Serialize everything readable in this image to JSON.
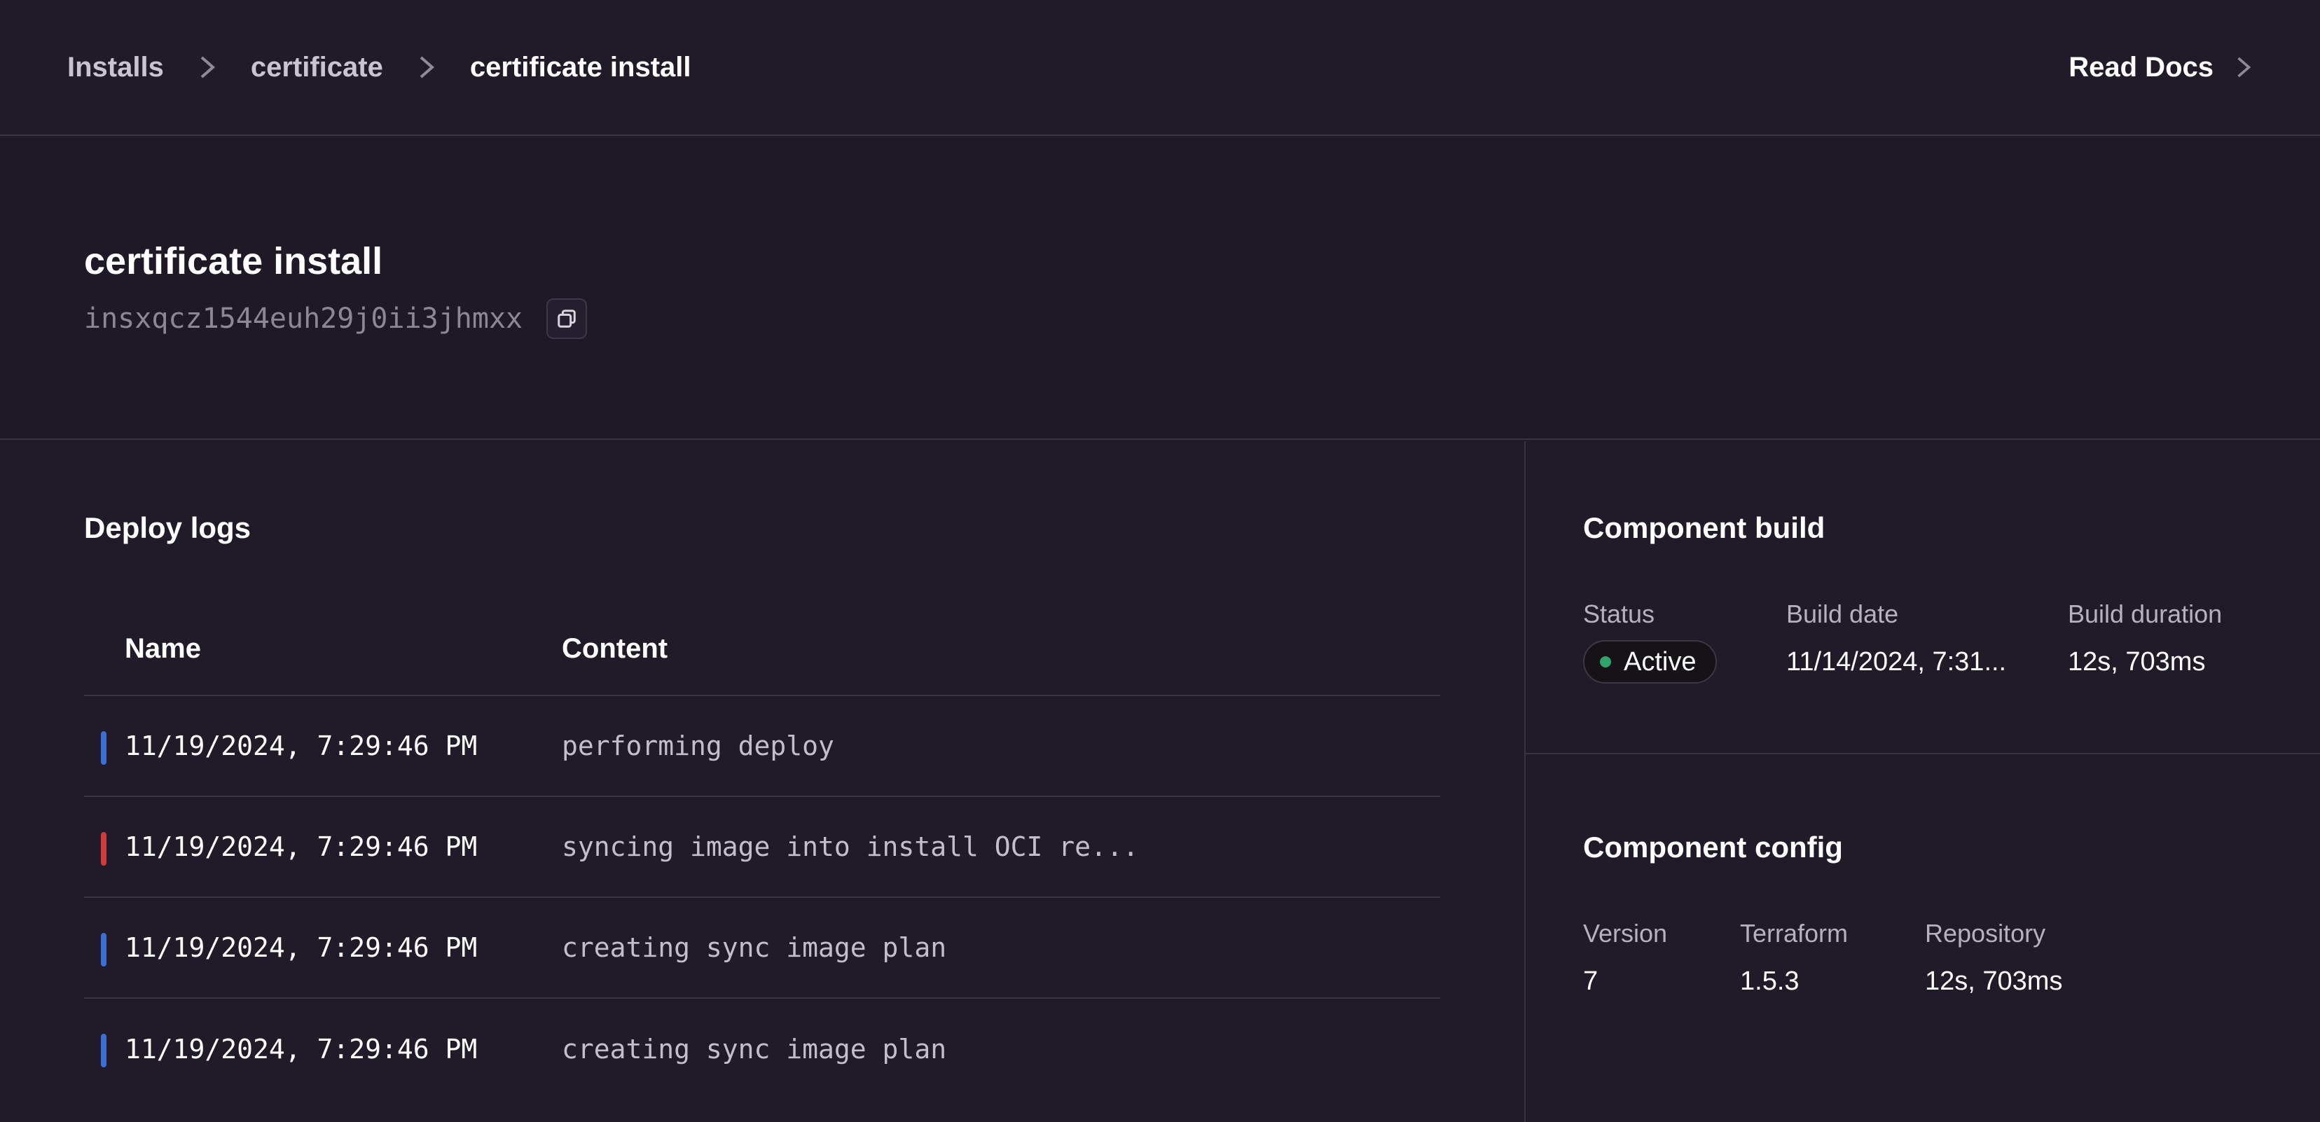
{
  "breadcrumb": {
    "items": [
      "Installs",
      "certificate",
      "certificate install"
    ]
  },
  "header_link": {
    "label": "Read Docs"
  },
  "page": {
    "title": "certificate install",
    "install_id": "insxqcz1544euh29j0ii3jhmxx"
  },
  "deploy_logs": {
    "title": "Deploy logs",
    "columns": [
      "Name",
      "Content"
    ],
    "rows": [
      {
        "name": "11/19/2024, 7:29:46 PM",
        "content": "performing deploy",
        "level_color": "#3b6fd6"
      },
      {
        "name": "11/19/2024, 7:29:46 PM",
        "content": "syncing image into install OCI re...",
        "level_color": "#d13b3b"
      },
      {
        "name": "11/19/2024, 7:29:46 PM",
        "content": "creating sync image plan",
        "level_color": "#3b6fd6"
      },
      {
        "name": "11/19/2024, 7:29:46 PM",
        "content": "creating sync image plan",
        "level_color": "#3b6fd6"
      }
    ]
  },
  "component_build": {
    "title": "Component build",
    "status_label": "Status",
    "status_value": "Active",
    "status_color": "#2fa36a",
    "build_date_label": "Build date",
    "build_date_value": "11/14/2024, 7:31...",
    "build_duration_label": "Build duration",
    "build_duration_value": "12s, 703ms"
  },
  "component_config": {
    "title": "Component config",
    "version_label": "Version",
    "version_value": "7",
    "terraform_label": "Terraform",
    "terraform_value": "1.5.3",
    "repository_label": "Repository",
    "repository_value": "12s, 703ms"
  },
  "colors": {
    "background": "#211a29",
    "border": "#3a3344",
    "info_bar": "#3b6fd6",
    "error_bar": "#d13b3b"
  }
}
